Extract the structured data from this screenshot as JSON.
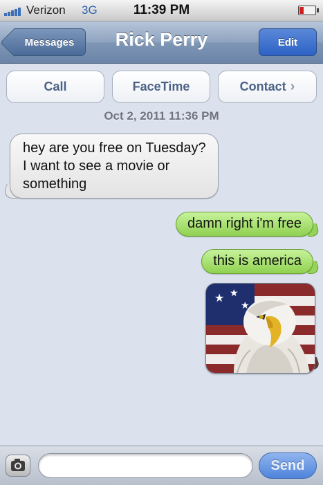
{
  "status_bar": {
    "carrier": "Verizon",
    "network": "3G",
    "time": "11:39 PM",
    "battery_color": "#d21d1d"
  },
  "nav": {
    "back_label": "Messages",
    "title": "Rick Perry",
    "edit_label": "Edit"
  },
  "actions": {
    "call_label": "Call",
    "facetime_label": "FaceTime",
    "contact_label": "Contact",
    "contact_chevron": "›"
  },
  "thread": {
    "timestamp": "Oct 2, 2011 11:36 PM",
    "messages": [
      {
        "from": "contact",
        "text": "hey are you free on Tuesday? I want to see a movie or something"
      },
      {
        "from": "me",
        "text": "damn right i'm free"
      },
      {
        "from": "me",
        "text": "this is america"
      },
      {
        "from": "me",
        "type": "image",
        "icon": "eagle-flag-photo"
      }
    ],
    "sent_bubble_color": "#8fd150",
    "received_bubble_color": "#e3e3e3"
  },
  "input_bar": {
    "camera_icon": "camera-icon",
    "text_value": "",
    "send_label": "Send"
  }
}
